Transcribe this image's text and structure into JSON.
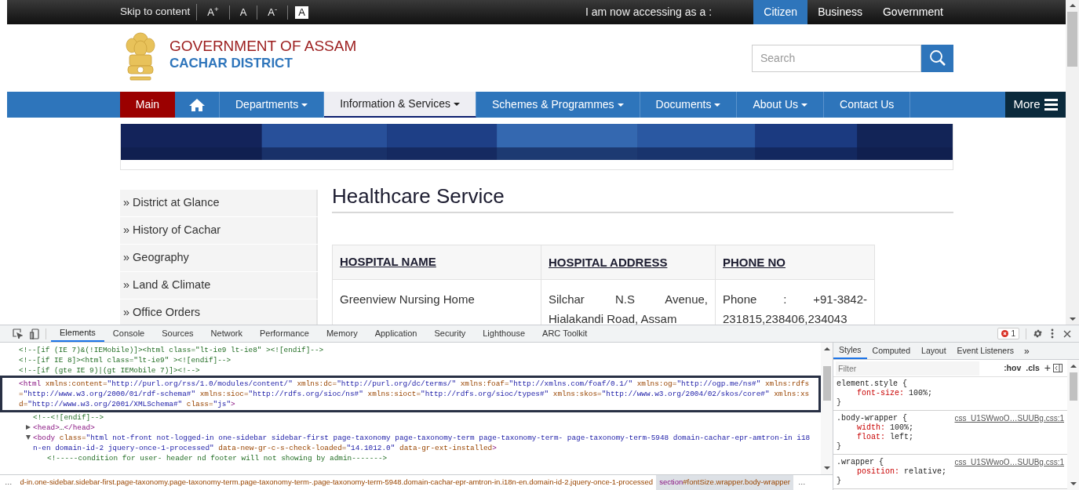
{
  "top_bar": {
    "skip_link": "Skip to content",
    "font_controls": [
      {
        "label": "A$^{+}$",
        "inverted": false
      },
      {
        "label": "A",
        "inverted": false
      },
      {
        "label": "A$^{-}$",
        "inverted": false
      },
      {
        "label": "A",
        "inverted": true
      }
    ],
    "accessing_label": "I am now accessing as a :",
    "audience_tabs": [
      {
        "label": "Citizen",
        "selected": true
      },
      {
        "label": "Business",
        "selected": false
      },
      {
        "label": "Government",
        "selected": false
      }
    ]
  },
  "header": {
    "title": "GOVERNMENT OF ASSAM",
    "subtitle": "CACHAR DISTRICT",
    "search": {
      "placeholder": "Search"
    }
  },
  "nav": {
    "items": [
      {
        "kind": "main",
        "label": "Main",
        "dropdown": false,
        "selected": false
      },
      {
        "kind": "home",
        "dropdown": false,
        "selected": false
      },
      {
        "kind": "menu",
        "label": "Departments",
        "dropdown": true,
        "selected": false
      },
      {
        "kind": "menu",
        "label": "Information & Services",
        "dropdown": true,
        "selected": true
      },
      {
        "kind": "menu",
        "label": "Schemes & Programmes",
        "dropdown": true,
        "selected": false
      },
      {
        "kind": "menu",
        "label": "Documents",
        "dropdown": true,
        "selected": false
      },
      {
        "kind": "menu",
        "label": "About Us",
        "dropdown": true,
        "selected": false
      },
      {
        "kind": "menu",
        "label": "Contact Us",
        "dropdown": false,
        "selected": false
      }
    ],
    "more": "More"
  },
  "sidebar": {
    "items": [
      "» District at Glance",
      "» History of Cachar",
      "» Geography",
      "» Land & Climate",
      "» Office Orders"
    ]
  },
  "content": {
    "title": "Healthcare Service",
    "table": {
      "columns": [
        "HOSPITAL NAME",
        "HOSPITAL ADDRESS",
        "PHONE NO"
      ],
      "rows": [
        [
          "Greenview Nursing Home",
          "Silchar N.S Avenue, Hialakandi Road, Assam",
          "Phone : +91-3842-231815,238406,234043"
        ]
      ]
    }
  },
  "devtools": {
    "tabs": [
      {
        "label": "Elements",
        "selected": true
      },
      {
        "label": "Console",
        "selected": false
      },
      {
        "label": "Sources",
        "selected": false
      },
      {
        "label": "Network",
        "selected": false
      },
      {
        "label": "Performance",
        "selected": false
      },
      {
        "label": "Memory",
        "selected": false
      },
      {
        "label": "Application",
        "selected": false
      },
      {
        "label": "Security",
        "selected": false
      },
      {
        "label": "Lighthouse",
        "selected": false
      },
      {
        "label": "ARC Toolkit",
        "selected": false
      }
    ],
    "error_count": "1",
    "dom": [
      {
        "kind": "comment",
        "selected": false,
        "text": "<!--[if (IE 7)&(!IEMobile)]><html class=\"lt-ie9 lt-ie8\" ><![endif]-->"
      },
      {
        "kind": "comment",
        "selected": false,
        "text": "<!--[if IE 8]><html class=\"lt-ie9\" ><![endif]-->"
      },
      {
        "kind": "comment",
        "selected": false,
        "text": "<!--[if (gte IE 9)|(gt IEMobile 7)]><!-->"
      },
      {
        "kind": "element",
        "selected": true,
        "tokens": [
          {
            "kind": "tag",
            "text": "<html"
          },
          {
            "kind": "attr",
            "text": "xmlns:content="
          },
          {
            "kind": "value",
            "text": "\"http://purl.org/rss/1.0/modules/content/\""
          },
          {
            "kind": "attr",
            "text": "xmlns:dc="
          },
          {
            "kind": "value",
            "text": "\"http://purl.org/dc/terms/\""
          },
          {
            "kind": "attr",
            "text": "xmlns:foaf="
          },
          {
            "kind": "value",
            "text": "\"http://xmlns.com/foaf/0.1/\""
          },
          {
            "kind": "attr",
            "text": "xmlns:og="
          },
          {
            "kind": "value",
            "text": "\"http://ogp.me/ns#\""
          },
          {
            "kind": "attr",
            "text": "xmlns:rdfs="
          },
          {
            "kind": "value",
            "text": "\"http://www.w3.org/2000/01/rdf-schema#\""
          },
          {
            "kind": "attr",
            "text": "xmlns:sioc="
          },
          {
            "kind": "value",
            "text": "\"http://rdfs.org/sioc/ns#\""
          },
          {
            "kind": "attr",
            "text": "xmlns:sioct="
          },
          {
            "kind": "value",
            "text": "\"http://rdfs.org/sioc/types#\""
          },
          {
            "kind": "attr",
            "text": "xmlns:skos="
          },
          {
            "kind": "value",
            "text": "\"http://www.w3.org/2004/02/skos/core#\""
          },
          {
            "kind": "attr",
            "text": "xmlns:xsd="
          },
          {
            "kind": "value",
            "text": "\"http://www.w3.org/2001/XMLSchema#\""
          },
          {
            "kind": "attr",
            "text": "class="
          },
          {
            "kind": "value",
            "text": "\"js\""
          },
          {
            "kind": "tag",
            "text": ">"
          }
        ],
        "children": [
          {
            "kind": "comment",
            "selected": false,
            "text": "<!--<![endif]-->"
          },
          {
            "kind": "element",
            "selected": false,
            "expanded": false,
            "tokens": [
              {
                "kind": "tag",
                "text": "<head>"
              },
              {
                "kind": "plain",
                "text": "…"
              },
              {
                "kind": "tag",
                "text": "</head>"
              }
            ]
          },
          {
            "kind": "element",
            "selected": false,
            "expanded": true,
            "tokens": [
              {
                "kind": "tag",
                "text": "<body"
              },
              {
                "kind": "attr",
                "text": "class="
              },
              {
                "kind": "value",
                "text": "\"html not-front not-logged-in one-sidebar sidebar-first page-taxonomy page-taxonomy-term page-taxonomy-term- page-taxonomy-term-5948 domain-cachar-epr-amtron-in i18n-en domain-id-2 jquery-once-1-processed\""
              },
              {
                "kind": "attr",
                "text": "data-new-gr-c-s-check-loaded="
              },
              {
                "kind": "value",
                "text": "\"14.1012.0\""
              },
              {
                "kind": "attr",
                "text": "data-gr-ext-installed"
              },
              {
                "kind": "tag",
                "text": ">"
              }
            ],
            "children": [
              {
                "kind": "comment",
                "selected": false,
                "text": "<!-----condition for user- header nd footer will not showing by admin------->"
              }
            ]
          }
        ]
      }
    ],
    "breadcrumbs": [
      {
        "rest": "d-in.one-sidebar.sidebar-first.page-taxonomy.page-taxonomy-term.page-taxonomy-term-.page-taxonomy-term-5948.domain-cachar-epr-amtron-in.i18n-en.domain-id-2.jquery-once-1-processed",
        "selected": false
      },
      {
        "tag": "section",
        "rest": "#fontSize.wrapper.body-wrapper",
        "selected": true
      }
    ],
    "breadcrumb_overflow": "…",
    "styles_tabs": [
      {
        "label": "Styles",
        "selected": true
      },
      {
        "label": "Computed",
        "selected": false
      },
      {
        "label": "Layout",
        "selected": false
      },
      {
        "label": "Event Listeners",
        "selected": false
      }
    ],
    "styles_more": "»",
    "filter_placeholder": "Filter",
    "hov": ":hov",
    "cls": ".cls",
    "add": "+",
    "rules": [
      {
        "selector": "element.style {",
        "properties": [
          {
            "name": "font-size:",
            "value": "100%;"
          }
        ],
        "close": "}"
      },
      {
        "selector": ".body-wrapper {",
        "source": "css_U1SWwoO…SUUBg.css:1",
        "properties": [
          {
            "name": "width:",
            "value": "100%;"
          },
          {
            "name": "float:",
            "value": "left;"
          }
        ],
        "close": "}"
      },
      {
        "selector": ".wrapper {",
        "source": "css_U1SWwoO…SUUBg.css:1",
        "properties": [
          {
            "name": "position:",
            "value": "relative;"
          }
        ],
        "close": "}"
      }
    ]
  }
}
